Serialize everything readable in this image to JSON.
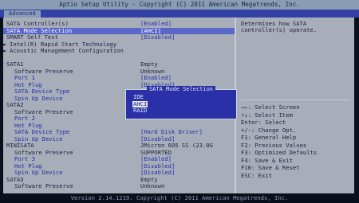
{
  "window": {
    "title": "Aptio Setup Utility - Copyright (C) 2011 American Megatrends, Inc.",
    "footer": "Version 2.14.1219. Copyright (C) 2011 American Megatrends, Inc."
  },
  "tabs": [
    {
      "label": "Advanced"
    }
  ],
  "settings": [
    {
      "label": "SATA Controller(s)",
      "value": "[Enabled]"
    },
    {
      "label": "SATA Mode Selection",
      "value": "[AHCI]"
    },
    {
      "label": "SMART Self Test",
      "value": "[Disabled]"
    },
    {
      "label": "Intel(R) Rapid Start Technology",
      "value": ""
    },
    {
      "label": "Acoustic Management Configuration",
      "value": ""
    },
    {
      "label": "SATA1",
      "value": "Empty"
    },
    {
      "label": "Software Preserve",
      "value": "Unknown"
    },
    {
      "label": "Port 1",
      "value": "[Enabled]"
    },
    {
      "label": "Hot Plug",
      "value": "[Disabled]"
    },
    {
      "label": "SATA Device Type",
      "value": ""
    },
    {
      "label": "Spin Up Device",
      "value": ""
    },
    {
      "label": "SATA2",
      "value": ""
    },
    {
      "label": "Software Preserve",
      "value": ""
    },
    {
      "label": "Port 2",
      "value": ""
    },
    {
      "label": "Hot Plug",
      "value": ""
    },
    {
      "label": "SATA Device Type",
      "value": "[Hard Disk Driver]"
    },
    {
      "label": "Spin Up Device",
      "value": "[Disabled]"
    },
    {
      "label": "MINISATA",
      "value": "JMicron 605 SS (23.0G"
    },
    {
      "label": "Software Preserve",
      "value": "SUPPORTED"
    },
    {
      "label": "Port 3",
      "value": "[Enabled]"
    },
    {
      "label": "Hot Plug",
      "value": "[Disabled]"
    },
    {
      "label": "Spin Up Device",
      "value": "[Disabled]"
    },
    {
      "label": "SATA3",
      "value": "Empty"
    },
    {
      "label": "Software Preserve",
      "value": "Unknown"
    }
  ],
  "help": {
    "text": "Determines how SATA controller(s) operate."
  },
  "keys": [
    "→←: Select Screen",
    "↑↓: Select Item",
    "Enter: Select",
    "+/-: Change Opt.",
    "F1: General Help",
    "F2: Previous Values",
    "F3: Optimized Defaults",
    "F4: Save & Exit",
    "F10: Save & Reset",
    "ESC: Exit"
  ],
  "popup": {
    "title": "SATA Mode Selection",
    "options": [
      "IDE",
      "AHCI",
      "RAID"
    ],
    "selected": "AHCI"
  },
  "colors": {
    "background": "#0a0f1c",
    "panel": "#a7adb9",
    "popup": "#2a31a8",
    "accent_blue": "#2230a8"
  }
}
